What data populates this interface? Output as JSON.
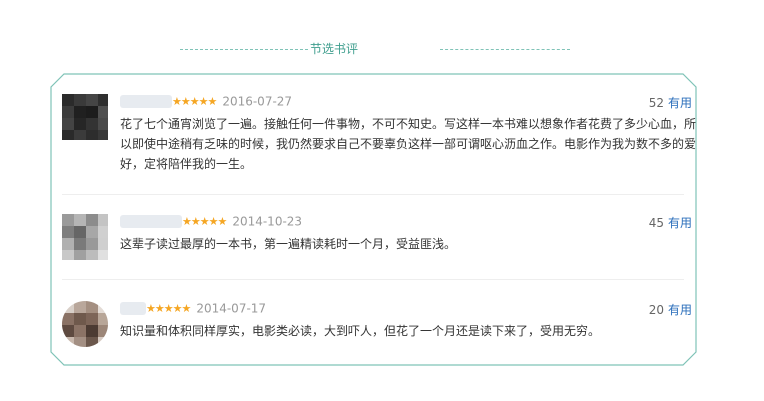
{
  "section": {
    "title": "节选书评"
  },
  "reviews": [
    {
      "stars": "★★★★★",
      "date": "2016-07-27",
      "useful_count": "52",
      "useful_label": "有用",
      "content": "花了七个通宵浏览了一遍。接触任何一件事物，不可不知史。写这样一本书难以想象作者花费了多少心血，所以即使中途稍有乏味的时候，我仍然要求自己不要辜负这样一部可谓呕心沥血之作。电影作为我为数不多的爱好，定将陪伴我的一生。"
    },
    {
      "stars": "★★★★★",
      "date": "2014-10-23",
      "useful_count": "45",
      "useful_label": "有用",
      "content": "这辈子读过最厚的一本书，第一遍精读耗时一个月，受益匪浅。"
    },
    {
      "stars": "★★★★★",
      "date": "2014-07-17",
      "useful_count": "20",
      "useful_label": "有用",
      "content": "知识量和体积同样厚实，电影类必读，大到吓人，但花了一个月还是读下来了，受用无穷。"
    }
  ],
  "colors": {
    "accent": "#3f9e8e",
    "border": "#7fc3b7",
    "star": "#f5a623",
    "link": "#2a6ebb"
  }
}
